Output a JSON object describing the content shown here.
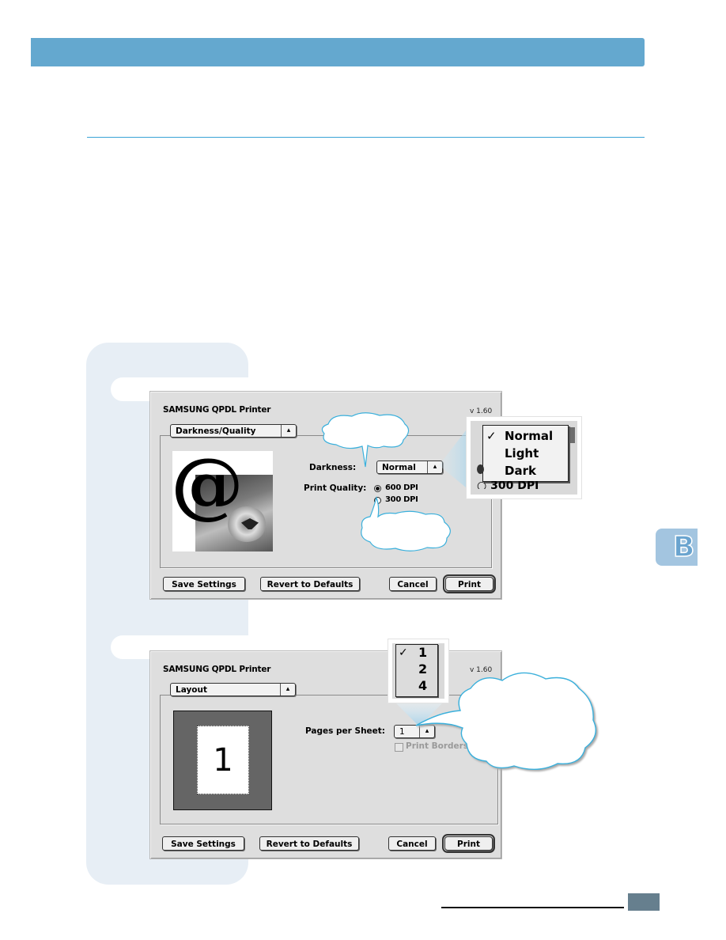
{
  "page": {
    "chapter_tab": "B",
    "header_bar_color": "#64a8cf",
    "rule_color": "#3aa4d6",
    "side_panel_color": "#e7eef5"
  },
  "dialog1": {
    "title": "SAMSUNG QPDL Printer",
    "version": "v 1.60",
    "panel_popup": "Darkness/Quality",
    "darkness_label": "Darkness:",
    "darkness_value": "Normal",
    "print_quality_label": "Print Quality:",
    "quality_options": [
      {
        "label": "600 DPI",
        "selected": true
      },
      {
        "label": "300 DPI",
        "selected": false
      }
    ],
    "preview_icon": "at-sign-sunflower-image",
    "buttons": {
      "save": "Save Settings",
      "revert": "Revert to Defaults",
      "cancel": "Cancel",
      "print": "Print"
    },
    "darkness_menu": {
      "items": [
        "Normal",
        "Light",
        "Dark"
      ],
      "checked": "Normal",
      "partial_behind": "300 DPI"
    }
  },
  "dialog2": {
    "title": "SAMSUNG QPDL Printer",
    "version": "v 1.60",
    "panel_popup": "Layout",
    "pages_per_sheet_label": "Pages per Sheet:",
    "pages_per_sheet_value": "1",
    "print_borders_label": "Print Borders",
    "print_borders_checked": false,
    "print_borders_enabled": false,
    "preview_page_number": "1",
    "buttons": {
      "save": "Save Settings",
      "revert": "Revert to Defaults",
      "cancel": "Cancel",
      "print": "Print"
    },
    "pages_menu": {
      "items": [
        "1",
        "2",
        "4"
      ],
      "checked": "1"
    }
  }
}
